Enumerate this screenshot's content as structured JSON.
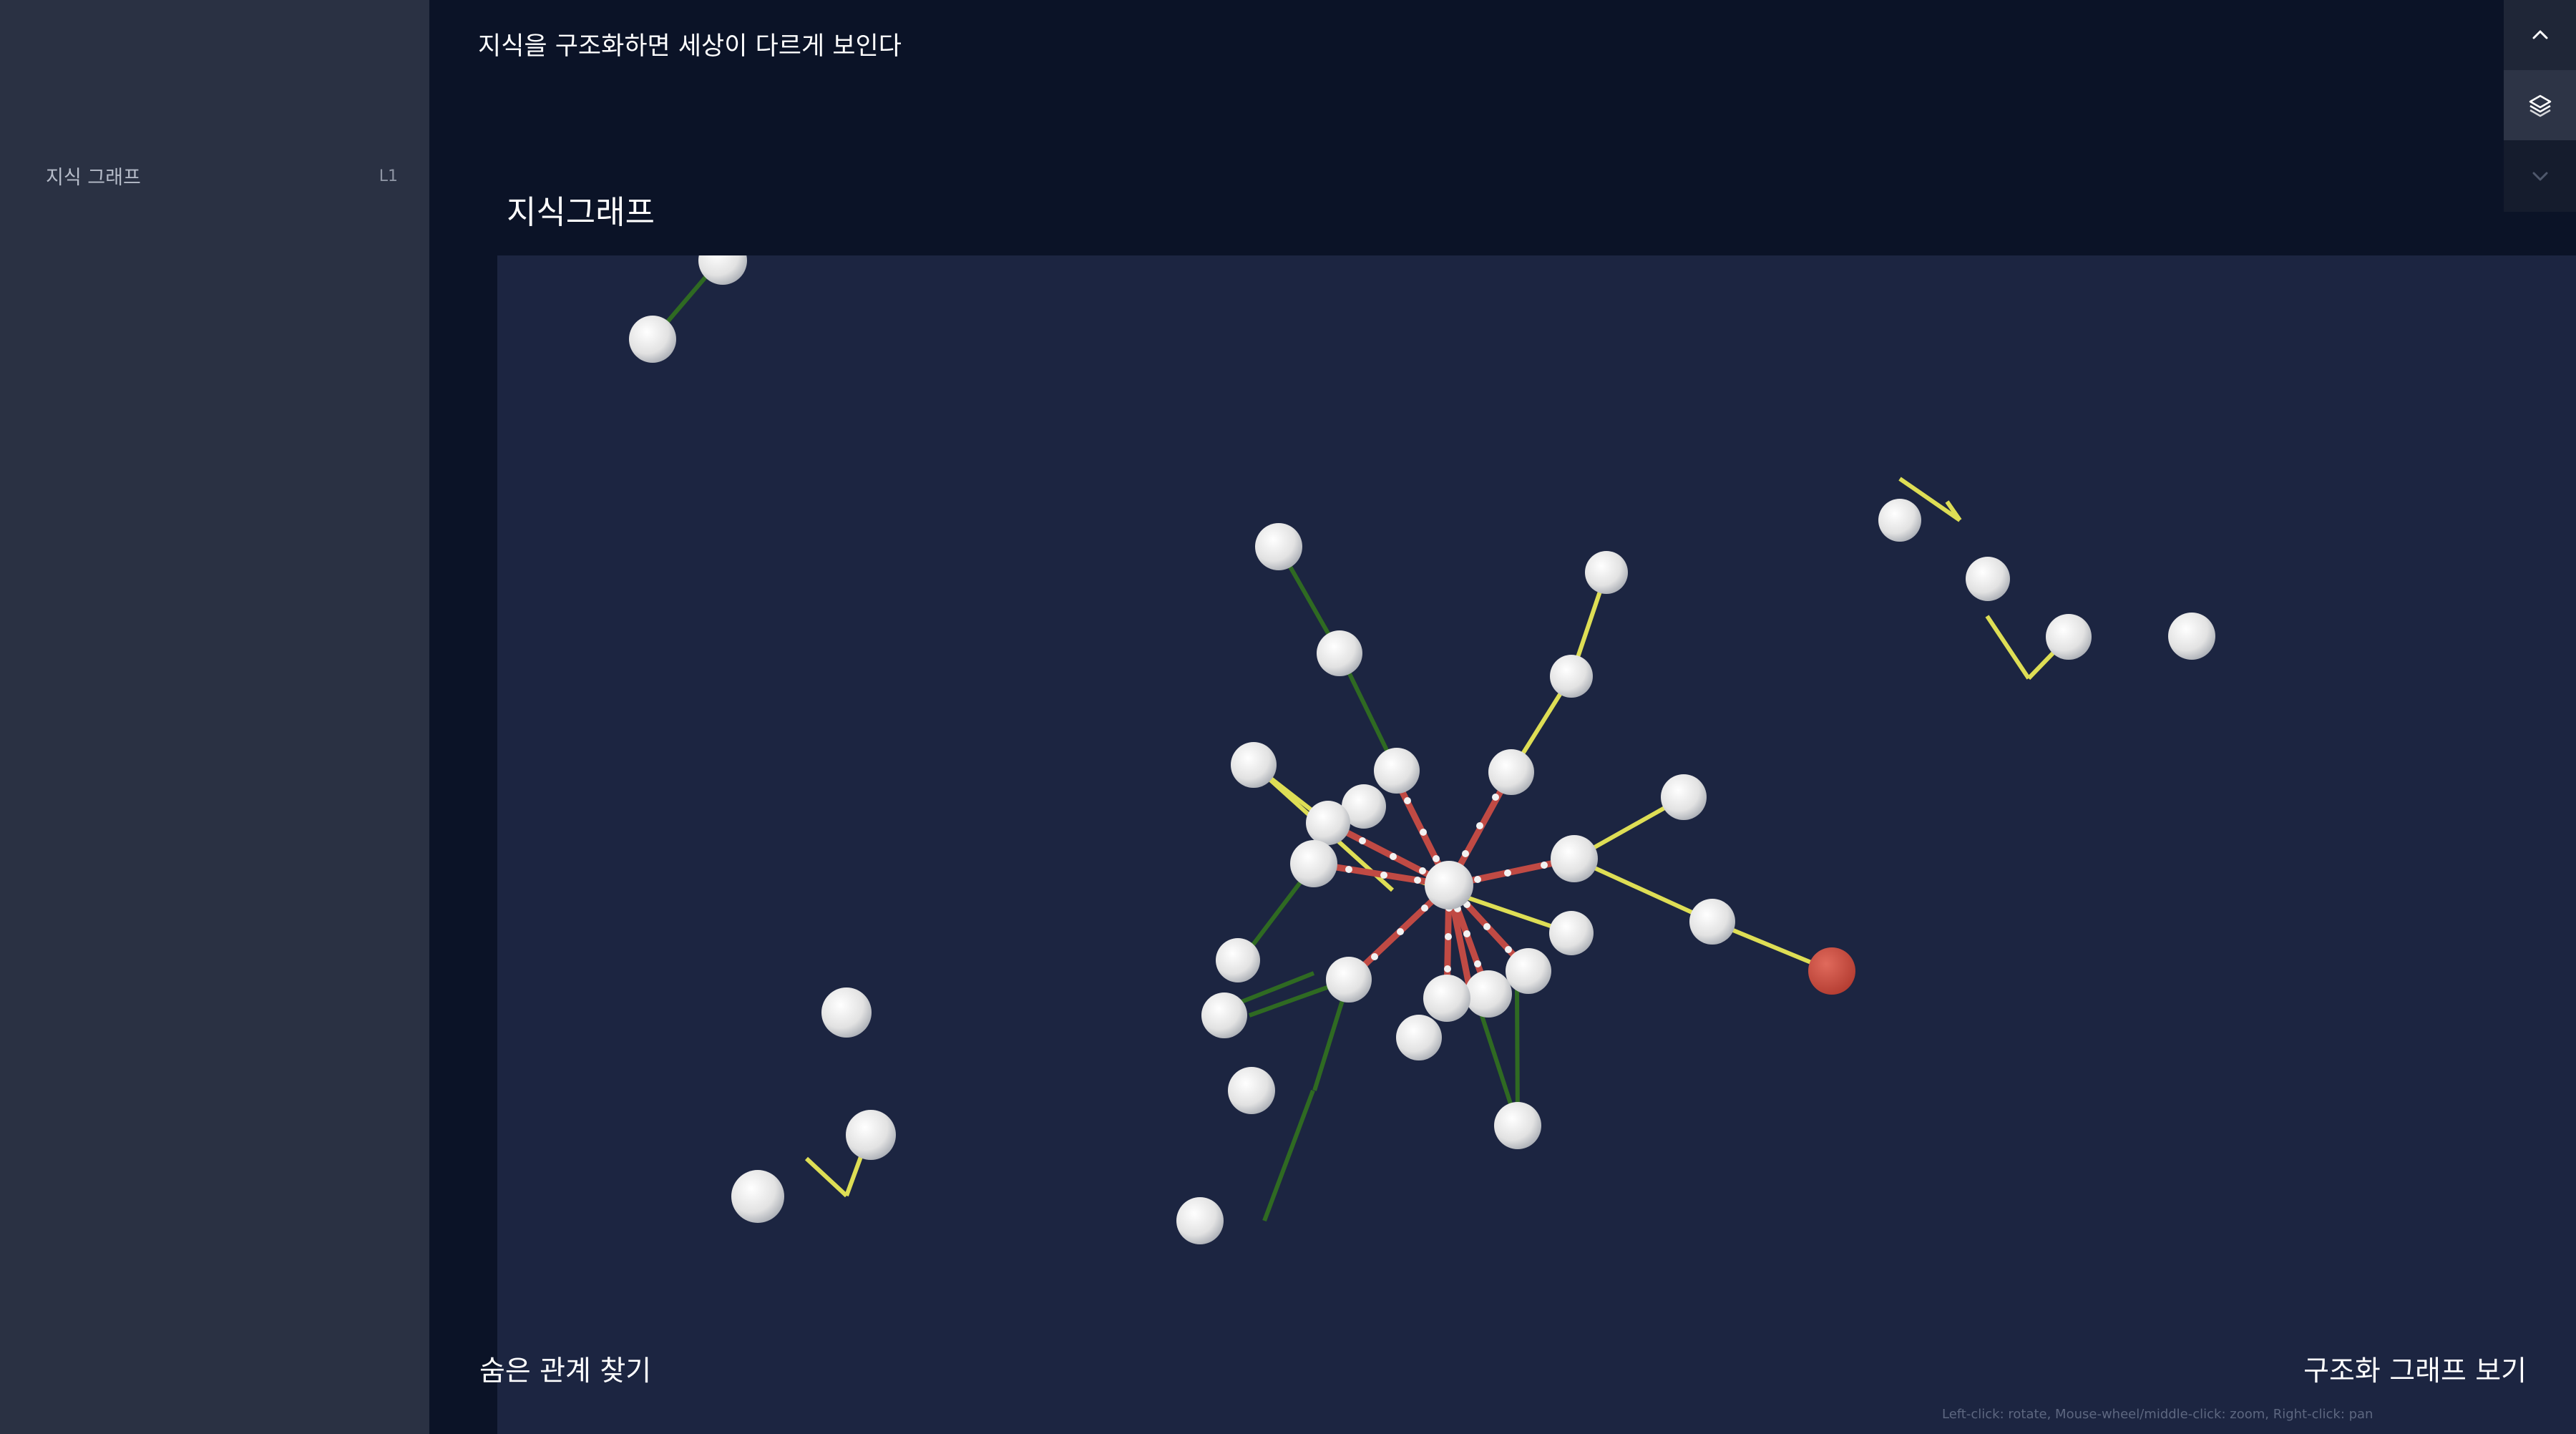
{
  "sidebar": {
    "items": [
      {
        "label": "지식 그래프",
        "level": "L1"
      }
    ]
  },
  "header": {
    "title": "지식을 구조화하면 세상이 다르게 보인다"
  },
  "section": {
    "title": "지식그래프"
  },
  "actions": {
    "hidden_relations": "숨은 관계 찾기",
    "view_structured_graph": "구조화 그래프 보기"
  },
  "graph": {
    "controls_hint": "Left-click: rotate, Mouse-wheel/middle-click: zoom, Right-click: pan",
    "colors": {
      "node": "#dcdcdc",
      "highlight_node": "#c8473b",
      "edge_green": "#2f6a22",
      "edge_yellow": "#dede55",
      "edge_red": "#c04a44",
      "panel_bg": "#1c2541"
    }
  },
  "toolbar": {
    "icons": [
      "chevron-up-icon",
      "layers-icon",
      "chevron-down-icon"
    ]
  }
}
